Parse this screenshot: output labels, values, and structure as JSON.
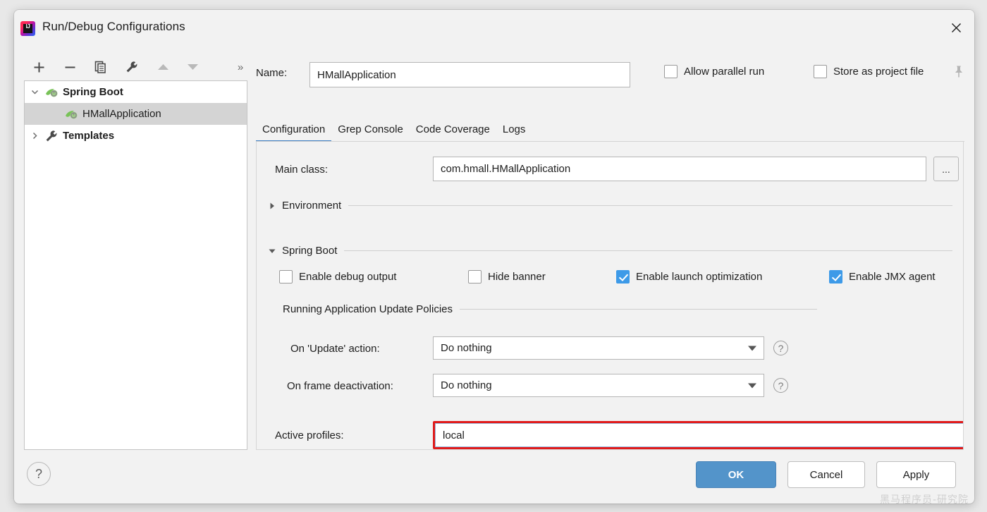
{
  "window": {
    "title": "Run/Debug Configurations",
    "app_icon": "intellij-idea-icon",
    "close_icon": "close-icon"
  },
  "tree_toolbar": {
    "add_label": "+",
    "remove_label": "−",
    "copy_icon": "copy-icon",
    "edit_templates_icon": "wrench-icon",
    "move_up_icon": "arrow-up-icon",
    "move_down_icon": "arrow-down-icon",
    "overflow_label": "»"
  },
  "tree": {
    "items": [
      {
        "label": "Spring Boot",
        "level": 0,
        "expanded": true,
        "icon": "spring-boot-icon",
        "selected": false
      },
      {
        "label": "HMallApplication",
        "level": 1,
        "expanded": null,
        "icon": "spring-boot-icon",
        "selected": true
      },
      {
        "label": "Templates",
        "level": 0,
        "expanded": false,
        "icon": "wrench-icon",
        "selected": false
      }
    ]
  },
  "header": {
    "name_label": "Name:",
    "name_value": "HMallApplication",
    "name_placeholder": "",
    "allow_parallel_run_label": "Allow parallel run",
    "allow_parallel_run_checked": false,
    "store_as_project_file_label": "Store as project file",
    "store_as_project_file_checked": false,
    "pin_icon": "pin-icon"
  },
  "tabs": [
    {
      "label": "Configuration",
      "active": true
    },
    {
      "label": "Grep Console",
      "active": false
    },
    {
      "label": "Code Coverage",
      "active": false
    },
    {
      "label": "Logs",
      "active": false
    }
  ],
  "configuration": {
    "main_class_label": "Main class:",
    "main_class_value": "com.hmall.HMallApplication",
    "main_class_browse_label": "...",
    "environment_section_title": "Environment",
    "environment_expanded": false,
    "spring_boot_section_title": "Spring Boot",
    "spring_boot_expanded": true,
    "checkboxes": [
      {
        "label": "Enable debug output",
        "checked": false
      },
      {
        "label": "Hide banner",
        "checked": false
      },
      {
        "label": "Enable launch optimization",
        "checked": true
      },
      {
        "label": "Enable JMX agent",
        "checked": true
      }
    ],
    "update_policies_title": "Running Application Update Policies",
    "on_update_action_label": "On 'Update' action:",
    "on_update_action_value": "Do nothing",
    "on_frame_deactivation_label": "On frame deactivation:",
    "on_frame_deactivation_value": "Do nothing",
    "help_icon_label": "?",
    "active_profiles_label": "Active profiles:",
    "active_profiles_value": "local"
  },
  "footer": {
    "help_label": "?",
    "ok_label": "OK",
    "cancel_label": "Cancel",
    "apply_label": "Apply"
  },
  "watermark": {
    "text": "黑马程序员-研究院"
  },
  "colors": {
    "accent_blue": "#3d9ae8",
    "tab_active_underline": "#3d7ec4",
    "ok_button": "#5394ca",
    "highlight_red": "#e01b1b",
    "dialog_bg": "#f2f2f2"
  }
}
